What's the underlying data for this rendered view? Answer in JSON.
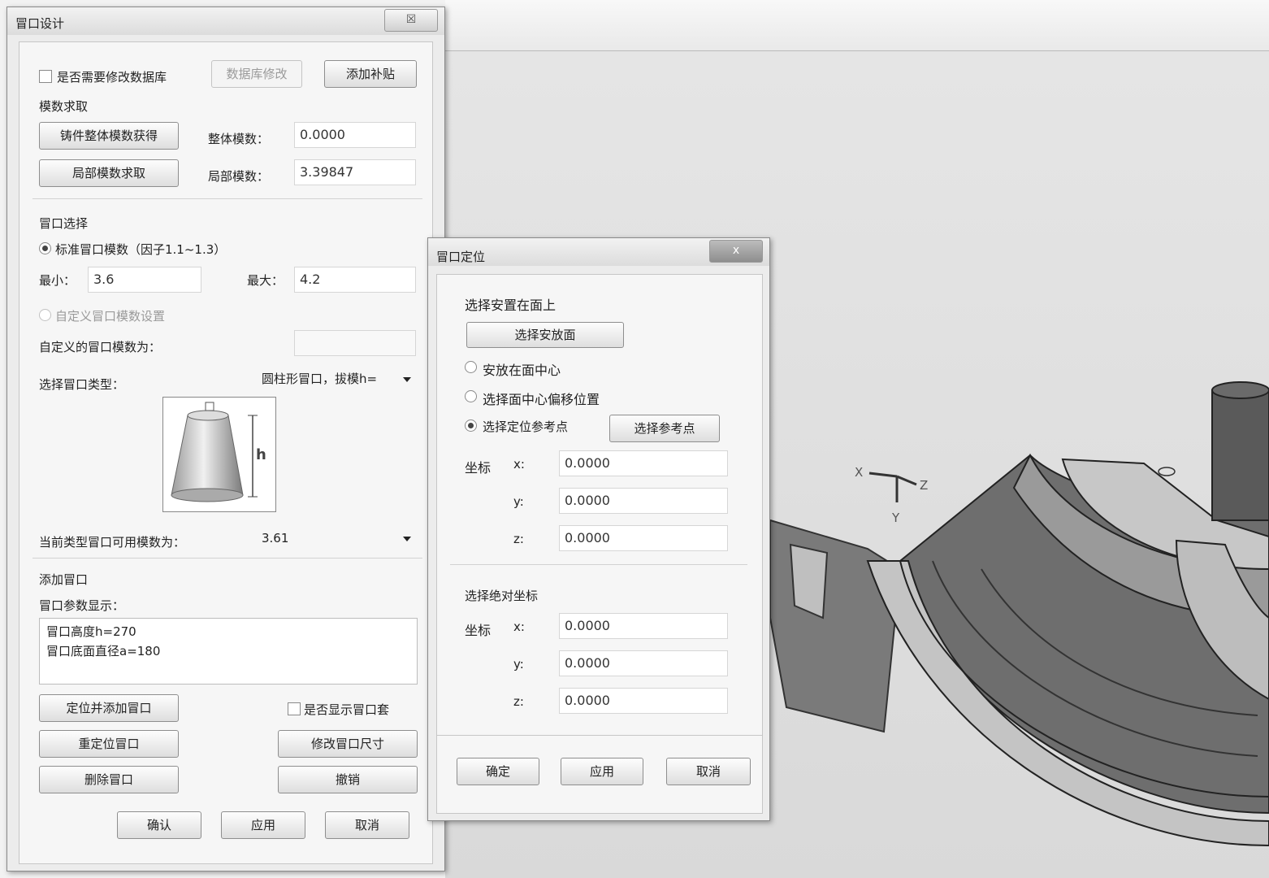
{
  "viewport": {
    "axis_x": "X",
    "axis_y": "Y",
    "axis_z": "Z"
  },
  "riser_design": {
    "title": "冒口设计",
    "close": "☒",
    "modify_db_label": "是否需要修改数据库",
    "db_modify_button": "数据库修改",
    "add_padding_button": "添加补贴",
    "modulus_section": "模数求取",
    "casting_modulus_button": "铸件整体模数获得",
    "overall_modulus_label": "整体模数：",
    "overall_modulus_value": "0.0000",
    "local_modulus_button": "局部模数求取",
    "local_modulus_label": "局部模数：",
    "local_modulus_value": "3.39847",
    "riser_select_section": "冒口选择",
    "standard_modulus_radio": "标准冒口模数（因子1.1~1.3）",
    "min_label": "最小：",
    "min_value": "3.6",
    "max_label": "最大：",
    "max_value": "4.2",
    "custom_modulus_radio": "自定义冒口模数设置",
    "custom_modulus_label": "自定义的冒口模数为：",
    "custom_modulus_value": "",
    "riser_type_label": "选择冒口类型：",
    "riser_type_value": "圆柱形冒口，拔模h=",
    "preview_h": "h",
    "available_modulus_label": "当前类型冒口可用模数为：",
    "available_modulus_value": "3.61",
    "add_riser_section": "添加冒口",
    "riser_params_label": "冒口参数显示：",
    "riser_params_lines": [
      "冒口高度h=270",
      "冒口底面直径a=180"
    ],
    "locate_add_button": "定位并添加冒口",
    "show_riser_sleeve_label": "是否显示冒口套",
    "relocate_button": "重定位冒口",
    "modify_size_button": "修改冒口尺寸",
    "delete_button": "删除冒口",
    "undo_button": "撤销",
    "ok_button": "确认",
    "apply_button": "应用",
    "cancel_button": "取消"
  },
  "riser_position": {
    "title": "冒口定位",
    "close": "x",
    "place_face_section": "选择安置在面上",
    "select_face_button": "选择安放面",
    "center_radio": "安放在面中心",
    "offset_radio": "选择面中心偏移位置",
    "ref_point_radio": "选择定位参考点",
    "select_ref_button": "选择参考点",
    "coord_label": "坐标",
    "x_label": "x:",
    "y_label": "y:",
    "z_label": "z:",
    "coord_x": "0.0000",
    "coord_y": "0.0000",
    "coord_z": "0.0000",
    "abs_coord_section": "选择绝对坐标",
    "abs_coord_label": "坐标",
    "abs_x": "0.0000",
    "abs_y": "0.0000",
    "abs_z": "0.0000",
    "ok_button": "确定",
    "apply_button": "应用",
    "cancel_button": "取消"
  }
}
